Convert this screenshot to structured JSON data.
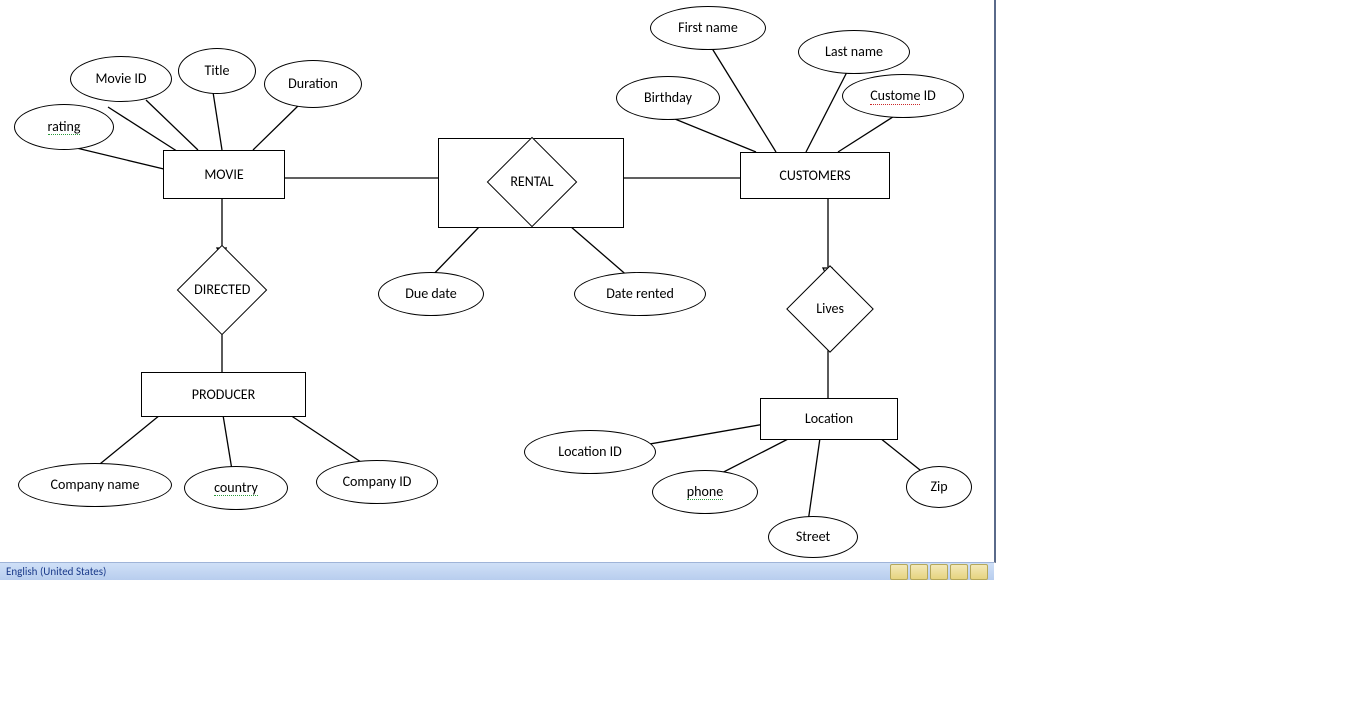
{
  "entities": {
    "movie": "MOVIE",
    "producer": "PRODUCER",
    "customers": "CUSTOMERS",
    "location": "Location"
  },
  "relationships": {
    "rental": "RENTAL",
    "directed": "DIRECTED",
    "lives": "Lives"
  },
  "attributes": {
    "movie_id": "Movie ID",
    "title": "Title",
    "duration": "Duration",
    "rating": "rating",
    "due_date": "Due date",
    "date_rented": "Date rented",
    "first_name": "First name",
    "last_name": "Last name",
    "birthday": "Birthday",
    "custome_id": "Custome",
    "custome_id_suffix": " ID",
    "company_name": "Company name",
    "country": "country",
    "company_id": "Company ID",
    "location_id": "Location ID",
    "phone": "phone",
    "street": "Street",
    "zip": "Zip"
  },
  "status": {
    "language": "English (United States)"
  }
}
